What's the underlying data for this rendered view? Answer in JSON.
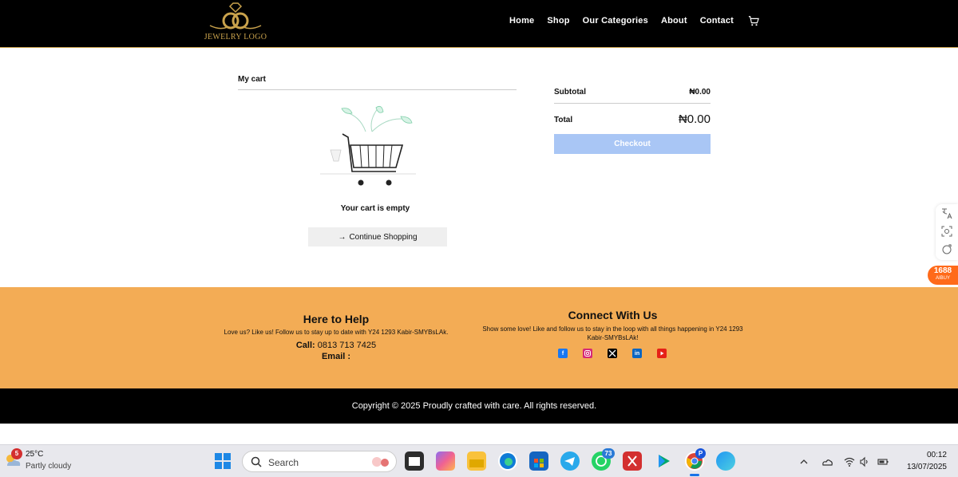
{
  "header": {
    "logo_text": "JEWELRY LOGO",
    "nav": [
      "Home",
      "Shop",
      "Our Categories",
      "About",
      "Contact"
    ],
    "cart_icon": "cart-icon"
  },
  "cart": {
    "title": "My cart",
    "empty_text": "Your cart is empty",
    "continue_label": "Continue Shopping"
  },
  "summary": {
    "subtotal_label": "Subtotal",
    "subtotal_value": "₦0.00",
    "total_label": "Total",
    "total_value": "₦0.00",
    "checkout_label": "Checkout"
  },
  "side_tools": {
    "badge_number": "1688",
    "badge_sub": "AIBUY"
  },
  "footer": {
    "help_title": "Here to Help",
    "help_sub": "Love us? Like us! Follow us to stay up to date with Y24 1293 Kabir-SMYBsLAk.",
    "call_label": "Call:",
    "call_value": "0813 713 7425",
    "email_label": "Email :",
    "connect_title": "Connect With Us",
    "connect_sub": "Show some love! Like and follow us to stay in the loop with all things happening in Y24 1293 Kabir-SMYBsLAk!",
    "socials": [
      "facebook-icon",
      "instagram-icon",
      "x-icon",
      "linkedin-icon",
      "youtube-icon"
    ],
    "copyright": "Copyright © 2025 Proudly crafted with care. All rights reserved."
  },
  "taskbar": {
    "weather_badge": "5",
    "temperature": "25°C",
    "condition": "Partly cloudy",
    "search_placeholder": "Search",
    "whatsapp_badge": "73",
    "chrome_badge": "P",
    "time": "00:12",
    "date": "13/07/2025"
  },
  "colors": {
    "header_bg": "#000000",
    "footer_bg": "#f3ac55",
    "checkout_bg": "#a9c6f5",
    "gold": "#c9a24c",
    "badge_orange": "#ff6a1a"
  }
}
